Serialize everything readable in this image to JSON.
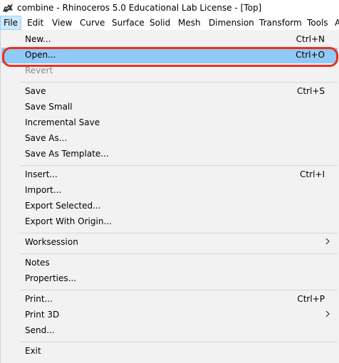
{
  "window": {
    "title": "combine - Rhinoceros 5.0 Educational Lab License - [Top]"
  },
  "menubar": [
    "File",
    "Edit",
    "View",
    "Curve",
    "Surface",
    "Solid",
    "Mesh",
    "Dimension",
    "Transform",
    "Tools",
    "A"
  ],
  "file_menu": {
    "new": {
      "label": "New...",
      "shortcut": "Ctrl+N"
    },
    "open": {
      "label": "Open...",
      "shortcut": "Ctrl+O"
    },
    "revert": {
      "label": "Revert"
    },
    "save": {
      "label": "Save",
      "shortcut": "Ctrl+S"
    },
    "save_small": {
      "label": "Save Small"
    },
    "incremental_save": {
      "label": "Incremental Save"
    },
    "save_as": {
      "label": "Save As..."
    },
    "save_as_template": {
      "label": "Save As Template..."
    },
    "insert": {
      "label": "Insert...",
      "shortcut": "Ctrl+I"
    },
    "import": {
      "label": "Import..."
    },
    "export_selected": {
      "label": "Export Selected..."
    },
    "export_with_origin": {
      "label": "Export With Origin..."
    },
    "worksession": {
      "label": "Worksession"
    },
    "notes": {
      "label": "Notes"
    },
    "properties": {
      "label": "Properties..."
    },
    "print": {
      "label": "Print...",
      "shortcut": "Ctrl+P"
    },
    "print_3d": {
      "label": "Print 3D"
    },
    "send": {
      "label": "Send..."
    },
    "exit": {
      "label": "Exit"
    }
  },
  "colors": {
    "highlight": "#91c9f7",
    "annotation_ring": "#e8321e",
    "menu_bg": "#f2f2f2"
  }
}
